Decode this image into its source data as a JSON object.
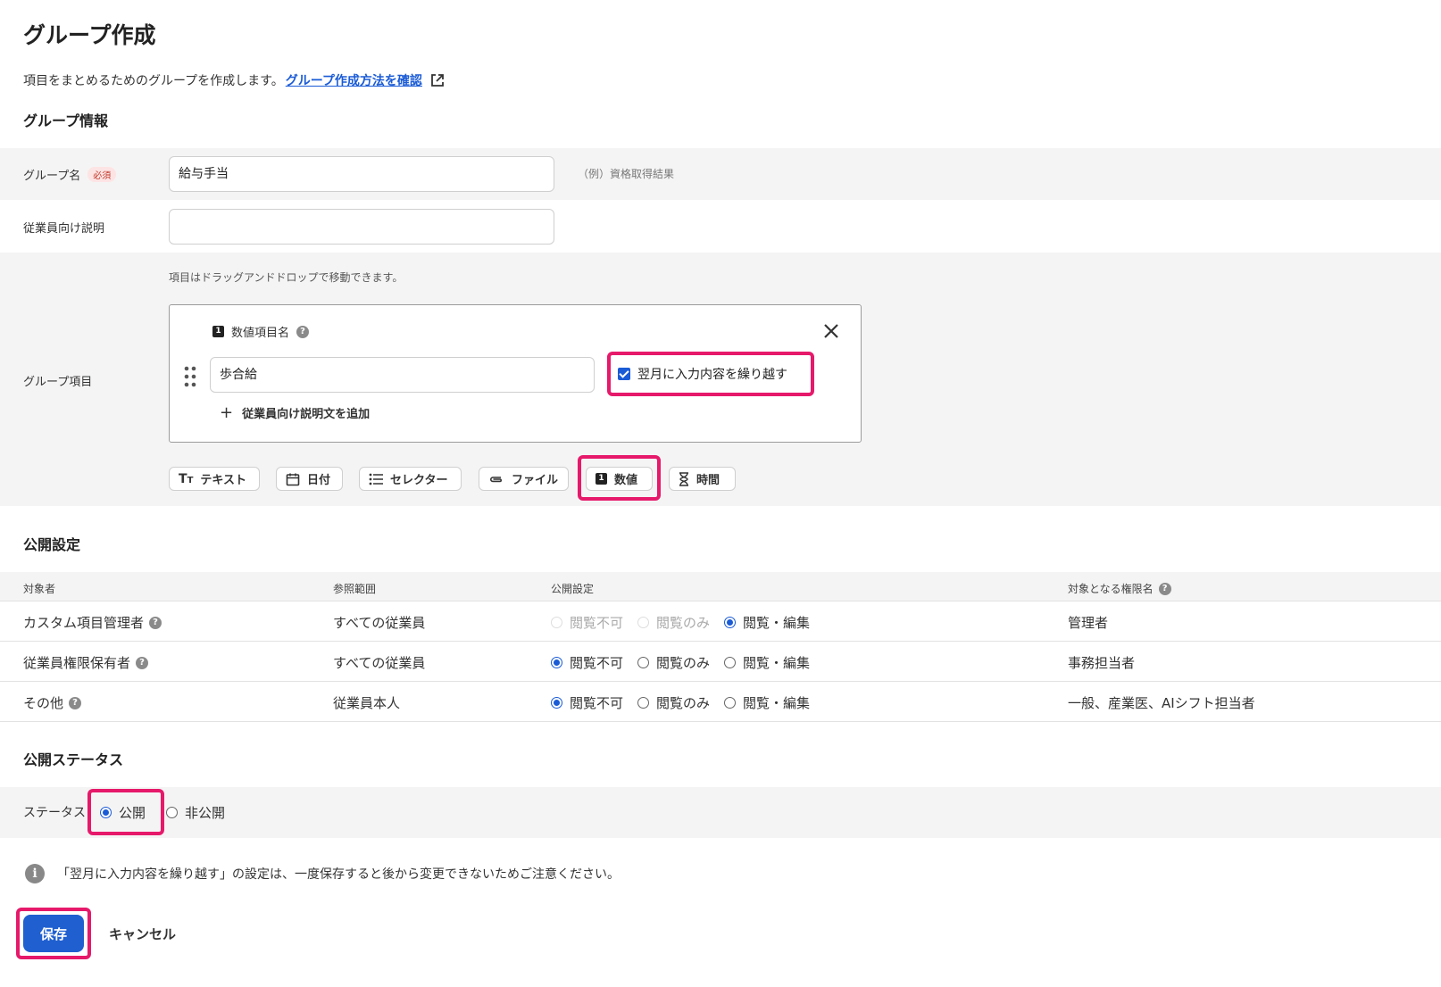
{
  "page": {
    "title": "グループ作成",
    "intro_text": "項目をまとめるためのグループを作成します。",
    "intro_link": "グループ作成方法を確認"
  },
  "group_info": {
    "section_title": "グループ情報",
    "name_label": "グループ名",
    "required_badge": "必須",
    "name_value": "給与手当",
    "name_example": "（例）資格取得結果",
    "desc_label": "従業員向け説明",
    "desc_value": "",
    "items_label": "グループ項目",
    "items_hint": "項目はドラッグアンドドロップで移動できます。",
    "item": {
      "type_badge": "1",
      "header": "数値項目名",
      "value": "歩合給",
      "carry_over_label": "翌月に入力内容を繰り越す",
      "carry_over_checked": true,
      "add_desc": "従業員向け説明文を追加"
    },
    "type_buttons": [
      {
        "label": "テキスト",
        "icon": "text-format-icon"
      },
      {
        "label": "日付",
        "icon": "calendar-icon"
      },
      {
        "label": "セレクター",
        "icon": "list-icon"
      },
      {
        "label": "ファイル",
        "icon": "paperclip-icon"
      },
      {
        "label": "数値",
        "icon": "number-icon"
      },
      {
        "label": "時間",
        "icon": "hourglass-icon"
      }
    ]
  },
  "visibility": {
    "section_title": "公開設定",
    "headers": [
      "対象者",
      "参照範囲",
      "公開設定",
      "対象となる権限名"
    ],
    "options": [
      "閲覧不可",
      "閲覧のみ",
      "閲覧・編集"
    ],
    "rows": [
      {
        "target": "カスタム項目管理者",
        "scope": "すべての従業員",
        "selected": 2,
        "disabled": [
          0,
          1
        ],
        "roles": "管理者"
      },
      {
        "target": "従業員権限保有者",
        "scope": "すべての従業員",
        "selected": 0,
        "disabled": [],
        "roles": "事務担当者"
      },
      {
        "target": "その他",
        "scope": "従業員本人",
        "selected": 0,
        "disabled": [],
        "roles": "一般、産業医、AIシフト担当者"
      }
    ]
  },
  "status": {
    "section_title": "公開ステータス",
    "label": "ステータス",
    "options": [
      "公開",
      "非公開"
    ],
    "selected": 0
  },
  "notice": "「翌月に入力内容を繰り越す」の設定は、一度保存すると後から変更できないためご注意ください。",
  "actions": {
    "save": "保存",
    "cancel": "キャンセル"
  },
  "colors": {
    "accent": "#1f5fd0",
    "highlight": "#e6196a",
    "row_bg": "#f5f4f4"
  }
}
